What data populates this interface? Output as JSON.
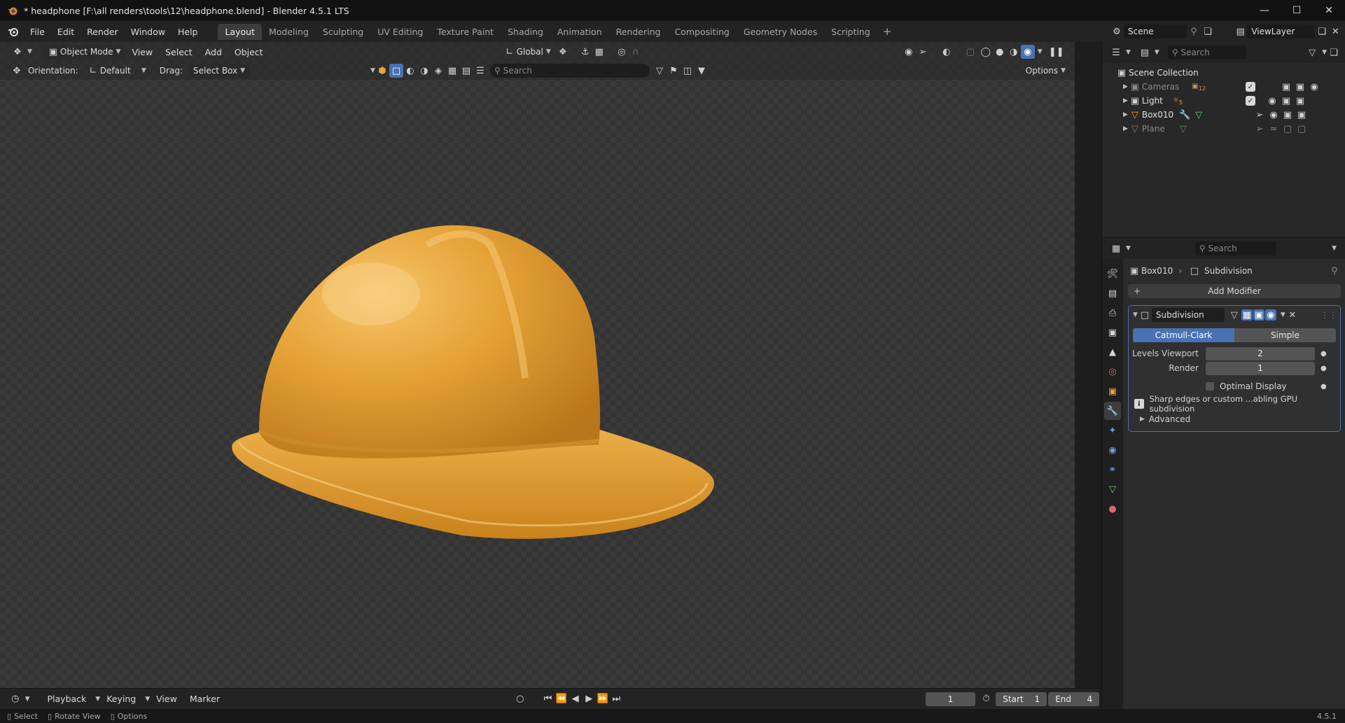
{
  "titlebar": {
    "title": "* headphone [F:\\all renders\\tools\\12\\headphone.blend] - Blender 4.5.1 LTS"
  },
  "menus": [
    "File",
    "Edit",
    "Render",
    "Window",
    "Help"
  ],
  "workspaces": [
    "Layout",
    "Modeling",
    "Sculpting",
    "UV Editing",
    "Texture Paint",
    "Shading",
    "Animation",
    "Rendering",
    "Compositing",
    "Geometry Nodes",
    "Scripting"
  ],
  "active_workspace": "Layout",
  "scene": {
    "name": "Scene",
    "view_layer": "ViewLayer"
  },
  "viewport": {
    "mode": "Object Mode",
    "menus": [
      "View",
      "Select",
      "Add",
      "Object"
    ],
    "transform_orientation": "Global",
    "orientation_label": "Orientation:",
    "orientation_value": "Default",
    "drag_label": "Drag:",
    "drag_value": "Select Box",
    "search_placeholder": "Search",
    "options_label": "Options"
  },
  "outliner": {
    "search_placeholder": "Search",
    "root": "Scene Collection",
    "items": [
      {
        "name": "Cameras",
        "extra": "12",
        "dim": true
      },
      {
        "name": "Light",
        "extra": "5",
        "dim": false
      },
      {
        "name": "Box010",
        "extra": "",
        "dim": false
      },
      {
        "name": "Plane",
        "extra": "",
        "dim": true
      }
    ]
  },
  "properties": {
    "search_placeholder": "Search",
    "breadcrumb_object": "Box010",
    "breadcrumb_modifier": "Subdivision",
    "add_modifier": "Add Modifier",
    "modifier": {
      "name": "Subdivision",
      "type_a": "Catmull-Clark",
      "type_b": "Simple",
      "levels_viewport_label": "Levels Viewport",
      "levels_viewport": "2",
      "render_label": "Render",
      "render": "1",
      "optimal_display": "Optimal Display",
      "info": "Sharp edges or custom ...abling GPU subdivision",
      "advanced": "Advanced"
    }
  },
  "timeline": {
    "menus": [
      "Playback",
      "Keying",
      "View",
      "Marker"
    ],
    "current_frame": "1",
    "start_label": "Start",
    "start": "1",
    "end_label": "End",
    "end": "4"
  },
  "statusbar": {
    "select": "Select",
    "rotate": "Rotate View",
    "options": "Options",
    "version": "4.5.1"
  },
  "colors": {
    "accent": "#4772b3",
    "helmet": "#e7a231"
  }
}
